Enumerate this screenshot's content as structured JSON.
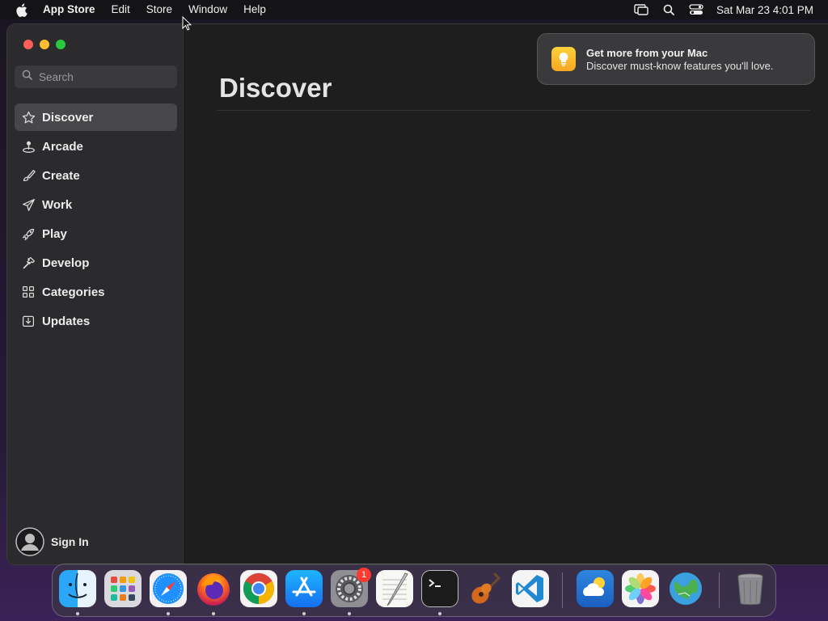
{
  "menubar": {
    "app_name": "App Store",
    "menus": [
      "Edit",
      "Store",
      "Window",
      "Help"
    ],
    "clock": "Sat Mar 23  4:01 PM",
    "status_icons": [
      "screen-mirroring-icon",
      "spotlight-search-icon",
      "control-center-icon"
    ]
  },
  "sidebar": {
    "search_placeholder": "Search",
    "items": [
      {
        "label": "Discover",
        "icon": "star-icon",
        "active": true
      },
      {
        "label": "Arcade",
        "icon": "joystick-icon",
        "active": false
      },
      {
        "label": "Create",
        "icon": "paintbrush-icon",
        "active": false
      },
      {
        "label": "Work",
        "icon": "paperplane-icon",
        "active": false
      },
      {
        "label": "Play",
        "icon": "rocket-icon",
        "active": false
      },
      {
        "label": "Develop",
        "icon": "hammer-icon",
        "active": false
      },
      {
        "label": "Categories",
        "icon": "grid-icon",
        "active": false
      },
      {
        "label": "Updates",
        "icon": "download-tray-icon",
        "active": false
      }
    ],
    "sign_in_label": "Sign In"
  },
  "main": {
    "title": "Discover"
  },
  "notification": {
    "title": "Get more from your Mac",
    "body": "Discover must-know features you'll love."
  },
  "dock": {
    "apps": [
      {
        "name": "Finder",
        "running": true
      },
      {
        "name": "Launchpad",
        "running": false
      },
      {
        "name": "Safari",
        "running": true
      },
      {
        "name": "Firefox",
        "running": true
      },
      {
        "name": "Chrome",
        "running": false
      },
      {
        "name": "App Store",
        "running": true
      },
      {
        "name": "System Settings",
        "running": true,
        "badge": "1"
      },
      {
        "name": "TextEdit",
        "running": false
      },
      {
        "name": "Terminal",
        "running": true
      },
      {
        "name": "GarageBand",
        "running": false
      },
      {
        "name": "Visual Studio Code",
        "running": false
      },
      {
        "name": "Weather",
        "running": false
      },
      {
        "name": "Photos",
        "running": false
      },
      {
        "name": "Maps",
        "running": false
      },
      {
        "name": "Trash",
        "running": false
      }
    ]
  }
}
